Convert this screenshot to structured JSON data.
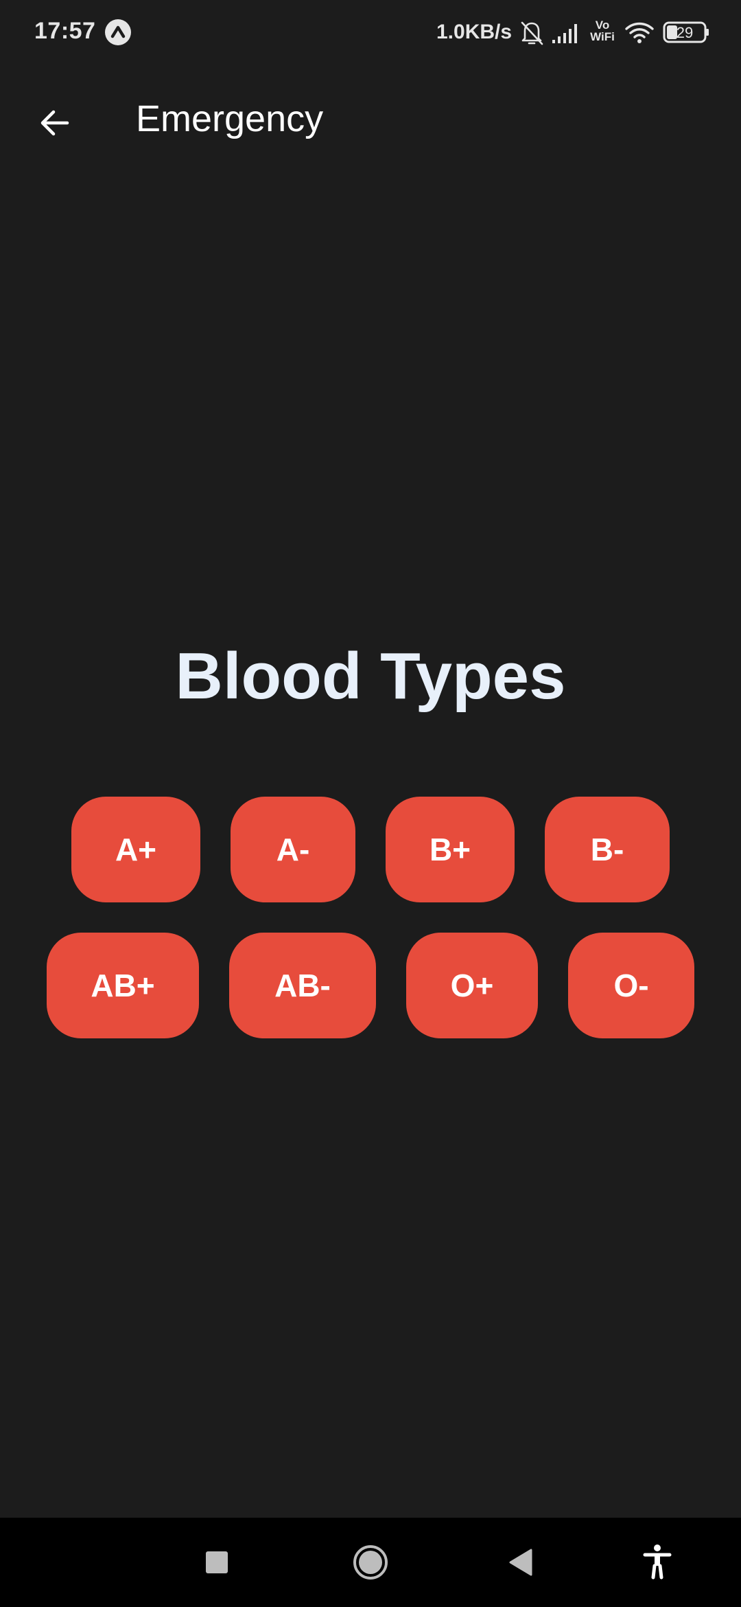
{
  "status_bar": {
    "time": "17:57",
    "app_icon": "caret-up-icon",
    "network_speed": "1.0KB/s",
    "icons": [
      "bell-off-icon",
      "signal-icon",
      "vowifi-icon",
      "wifi-icon",
      "battery-icon"
    ],
    "vowifi_top": "Vo",
    "vowifi_bottom": "WiFi",
    "battery_level": "29"
  },
  "app_bar": {
    "back_icon": "arrow-left-icon",
    "title": "Emergency"
  },
  "main": {
    "heading": "Blood Types",
    "blood_types_row_1": [
      "A+",
      "A-",
      "B+",
      "B-"
    ],
    "blood_types_row_2": [
      "AB+",
      "AB-",
      "O+",
      "O-"
    ]
  },
  "nav_bar": {
    "icons": [
      "recents-square-icon",
      "home-circle-icon",
      "back-triangle-icon",
      "accessibility-icon"
    ]
  },
  "colors": {
    "background": "#1c1c1c",
    "chip": "#e74c3c",
    "heading": "#e8f0fa",
    "nav_background": "#000000"
  }
}
